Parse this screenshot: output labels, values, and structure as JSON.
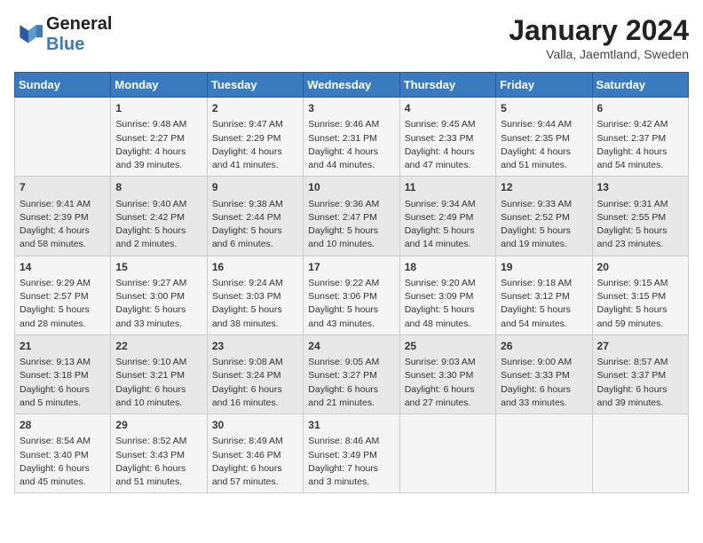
{
  "header": {
    "logo_line1": "General",
    "logo_line2": "Blue",
    "month_year": "January 2024",
    "location": "Valla, Jaemtland, Sweden"
  },
  "days_of_week": [
    "Sunday",
    "Monday",
    "Tuesday",
    "Wednesday",
    "Thursday",
    "Friday",
    "Saturday"
  ],
  "weeks": [
    [
      {
        "day": "",
        "info": ""
      },
      {
        "day": "1",
        "info": "Sunrise: 9:48 AM\nSunset: 2:27 PM\nDaylight: 4 hours\nand 39 minutes."
      },
      {
        "day": "2",
        "info": "Sunrise: 9:47 AM\nSunset: 2:29 PM\nDaylight: 4 hours\nand 41 minutes."
      },
      {
        "day": "3",
        "info": "Sunrise: 9:46 AM\nSunset: 2:31 PM\nDaylight: 4 hours\nand 44 minutes."
      },
      {
        "day": "4",
        "info": "Sunrise: 9:45 AM\nSunset: 2:33 PM\nDaylight: 4 hours\nand 47 minutes."
      },
      {
        "day": "5",
        "info": "Sunrise: 9:44 AM\nSunset: 2:35 PM\nDaylight: 4 hours\nand 51 minutes."
      },
      {
        "day": "6",
        "info": "Sunrise: 9:42 AM\nSunset: 2:37 PM\nDaylight: 4 hours\nand 54 minutes."
      }
    ],
    [
      {
        "day": "7",
        "info": "Sunrise: 9:41 AM\nSunset: 2:39 PM\nDaylight: 4 hours\nand 58 minutes."
      },
      {
        "day": "8",
        "info": "Sunrise: 9:40 AM\nSunset: 2:42 PM\nDaylight: 5 hours\nand 2 minutes."
      },
      {
        "day": "9",
        "info": "Sunrise: 9:38 AM\nSunset: 2:44 PM\nDaylight: 5 hours\nand 6 minutes."
      },
      {
        "day": "10",
        "info": "Sunrise: 9:36 AM\nSunset: 2:47 PM\nDaylight: 5 hours\nand 10 minutes."
      },
      {
        "day": "11",
        "info": "Sunrise: 9:34 AM\nSunset: 2:49 PM\nDaylight: 5 hours\nand 14 minutes."
      },
      {
        "day": "12",
        "info": "Sunrise: 9:33 AM\nSunset: 2:52 PM\nDaylight: 5 hours\nand 19 minutes."
      },
      {
        "day": "13",
        "info": "Sunrise: 9:31 AM\nSunset: 2:55 PM\nDaylight: 5 hours\nand 23 minutes."
      }
    ],
    [
      {
        "day": "14",
        "info": "Sunrise: 9:29 AM\nSunset: 2:57 PM\nDaylight: 5 hours\nand 28 minutes."
      },
      {
        "day": "15",
        "info": "Sunrise: 9:27 AM\nSunset: 3:00 PM\nDaylight: 5 hours\nand 33 minutes."
      },
      {
        "day": "16",
        "info": "Sunrise: 9:24 AM\nSunset: 3:03 PM\nDaylight: 5 hours\nand 38 minutes."
      },
      {
        "day": "17",
        "info": "Sunrise: 9:22 AM\nSunset: 3:06 PM\nDaylight: 5 hours\nand 43 minutes."
      },
      {
        "day": "18",
        "info": "Sunrise: 9:20 AM\nSunset: 3:09 PM\nDaylight: 5 hours\nand 48 minutes."
      },
      {
        "day": "19",
        "info": "Sunrise: 9:18 AM\nSunset: 3:12 PM\nDaylight: 5 hours\nand 54 minutes."
      },
      {
        "day": "20",
        "info": "Sunrise: 9:15 AM\nSunset: 3:15 PM\nDaylight: 5 hours\nand 59 minutes."
      }
    ],
    [
      {
        "day": "21",
        "info": "Sunrise: 9:13 AM\nSunset: 3:18 PM\nDaylight: 6 hours\nand 5 minutes."
      },
      {
        "day": "22",
        "info": "Sunrise: 9:10 AM\nSunset: 3:21 PM\nDaylight: 6 hours\nand 10 minutes."
      },
      {
        "day": "23",
        "info": "Sunrise: 9:08 AM\nSunset: 3:24 PM\nDaylight: 6 hours\nand 16 minutes."
      },
      {
        "day": "24",
        "info": "Sunrise: 9:05 AM\nSunset: 3:27 PM\nDaylight: 6 hours\nand 21 minutes."
      },
      {
        "day": "25",
        "info": "Sunrise: 9:03 AM\nSunset: 3:30 PM\nDaylight: 6 hours\nand 27 minutes."
      },
      {
        "day": "26",
        "info": "Sunrise: 9:00 AM\nSunset: 3:33 PM\nDaylight: 6 hours\nand 33 minutes."
      },
      {
        "day": "27",
        "info": "Sunrise: 8:57 AM\nSunset: 3:37 PM\nDaylight: 6 hours\nand 39 minutes."
      }
    ],
    [
      {
        "day": "28",
        "info": "Sunrise: 8:54 AM\nSunset: 3:40 PM\nDaylight: 6 hours\nand 45 minutes."
      },
      {
        "day": "29",
        "info": "Sunrise: 8:52 AM\nSunset: 3:43 PM\nDaylight: 6 hours\nand 51 minutes."
      },
      {
        "day": "30",
        "info": "Sunrise: 8:49 AM\nSunset: 3:46 PM\nDaylight: 6 hours\nand 57 minutes."
      },
      {
        "day": "31",
        "info": "Sunrise: 8:46 AM\nSunset: 3:49 PM\nDaylight: 7 hours\nand 3 minutes."
      },
      {
        "day": "",
        "info": ""
      },
      {
        "day": "",
        "info": ""
      },
      {
        "day": "",
        "info": ""
      }
    ]
  ]
}
